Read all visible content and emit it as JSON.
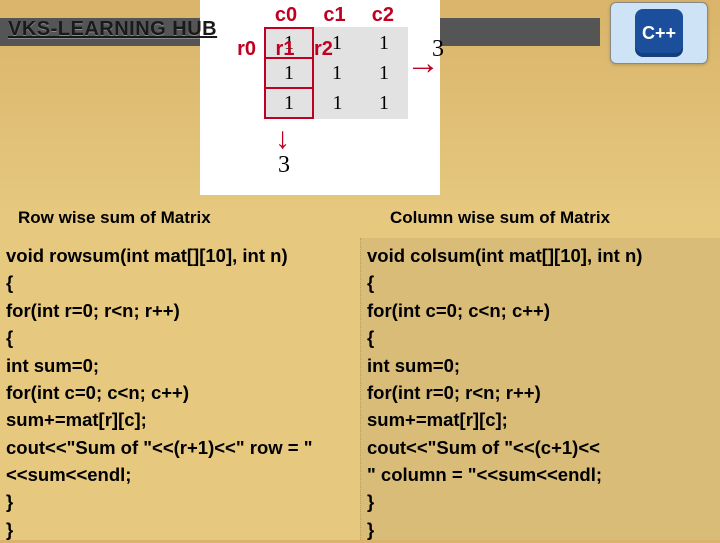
{
  "brand": "VKS-LEARNING HUB",
  "cpp_label": "C++",
  "matrix": {
    "col_headers": [
      "c0",
      "c1",
      "c2"
    ],
    "row_headers": [
      "r0",
      "r1",
      "r2"
    ],
    "cells": [
      [
        1,
        1,
        1
      ],
      [
        1,
        1,
        1
      ],
      [
        1,
        1,
        1
      ]
    ],
    "row_sum_display": "3",
    "col_sum_display": "3"
  },
  "subtitle_left": "Row wise sum of Matrix",
  "subtitle_right": "Column  wise sum of Matrix",
  "code_left": "void rowsum(int mat[][10], int n)\n{\nfor(int r=0; r<n; r++)\n{\nint sum=0;\nfor(int c=0; c<n; c++)\nsum+=mat[r][c];\ncout<<\"Sum of \"<<(r+1)<<\" row = \"<<sum<<endl;\n}\n}",
  "code_right": "void colsum(int mat[][10], int n)\n{\nfor(int c=0; c<n; c++)\n{\nint sum=0;\nfor(int r=0; r<n; r++)\nsum+=mat[r][c];\ncout<<\"Sum of \"<<(c+1)<<\n\" column = \"<<sum<<endl;\n}\n}"
}
